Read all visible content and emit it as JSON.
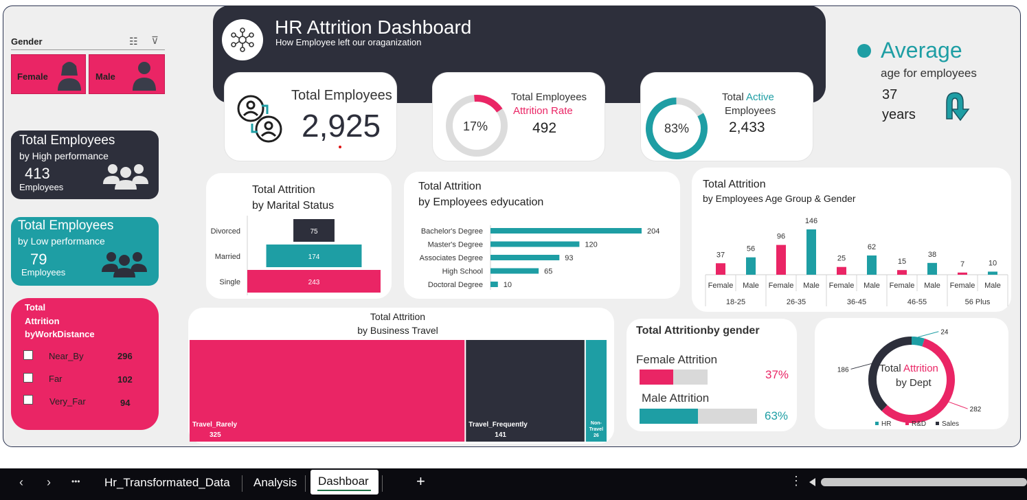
{
  "header": {
    "title": "HR Attrition Dashboard",
    "subtitle": "How Employee left our oraganization"
  },
  "slicer": {
    "title": "Gender",
    "items": [
      "Female",
      "Male"
    ]
  },
  "average": {
    "heading": "Average",
    "sub": "age for employees",
    "value": "37",
    "unit": "years"
  },
  "kpi_total": {
    "label": "Total Employees",
    "value": "2,925"
  },
  "kpi_attrition": {
    "line1": "Total Employees",
    "line2": "Attrition Rate",
    "value": "492",
    "pct_label": "17%",
    "pct": 0.17
  },
  "kpi_active": {
    "line1a": "Total ",
    "line1b": "Active",
    "line2": "Employees",
    "value": "2,433",
    "pct_label": "83%",
    "pct": 0.83
  },
  "high_perf": {
    "title": "Total Employees",
    "sub": "by High performance",
    "value": "413",
    "unit": "Employees"
  },
  "low_perf": {
    "title": "Total Employees",
    "sub": "by Low performance",
    "value": "79",
    "unit": "Employees"
  },
  "distance": {
    "title1": "Total",
    "title2": "Attrition",
    "title3": "byWorkDistance",
    "rows": [
      {
        "label": "Near_By",
        "value": "296"
      },
      {
        "label": "Far",
        "value": "102"
      },
      {
        "label": "Very_Far",
        "value": "94"
      }
    ]
  },
  "colors": {
    "pink": "#ea2565",
    "teal": "#1e9ea4",
    "dark": "#2d2f3b"
  },
  "chart_data": [
    {
      "type": "bar",
      "id": "marital",
      "title": "Total Attrition",
      "subtitle": "by Marital Status",
      "categories": [
        "Divorced",
        "Married",
        "Single"
      ],
      "values": [
        75,
        174,
        243
      ]
    },
    {
      "type": "bar",
      "id": "education",
      "title": "Total Attrition",
      "subtitle": "by Employees edyucation",
      "categories": [
        "Bachelor's Degree",
        "Master's Degree",
        "Associates Degree",
        "High School",
        "Doctoral Degree"
      ],
      "values": [
        204,
        120,
        93,
        65,
        10
      ]
    },
    {
      "type": "bar",
      "id": "agegender",
      "title": "Total Attrition",
      "subtitle": "by Employees Age Group & Gender",
      "groups": [
        "18-25",
        "26-35",
        "36-45",
        "46-55",
        "56 Plus"
      ],
      "genders": [
        "Female",
        "Male"
      ],
      "values": [
        [
          37,
          56
        ],
        [
          96,
          146
        ],
        [
          25,
          62
        ],
        [
          15,
          38
        ],
        [
          7,
          10
        ]
      ]
    },
    {
      "type": "heatmap",
      "id": "travel",
      "title": "Total Attrition",
      "subtitle": "by Business Travel",
      "categories": [
        "Travel_Rarely",
        "Travel_Frequently",
        "Non-Travel"
      ],
      "values": [
        325,
        141,
        26
      ]
    },
    {
      "type": "bar",
      "id": "gender",
      "title": "Total Attritionby gender",
      "categories": [
        "Female Attrition",
        "Male Attrition"
      ],
      "values": [
        0.37,
        0.63
      ],
      "labels": [
        "37%",
        "63%"
      ]
    },
    {
      "type": "pie",
      "id": "dept",
      "title_a": "Total ",
      "title_b": "Attrition",
      "title_c": "by Dept",
      "categories": [
        "HR",
        "R&D",
        "Sales"
      ],
      "values": [
        24,
        282,
        186
      ]
    }
  ],
  "sheet_tabs": {
    "tabs": [
      "Hr_Transformated_Data",
      "Analysis",
      "Dashboar"
    ],
    "active": "Dashboar",
    "more": "•••",
    "add": "+"
  }
}
